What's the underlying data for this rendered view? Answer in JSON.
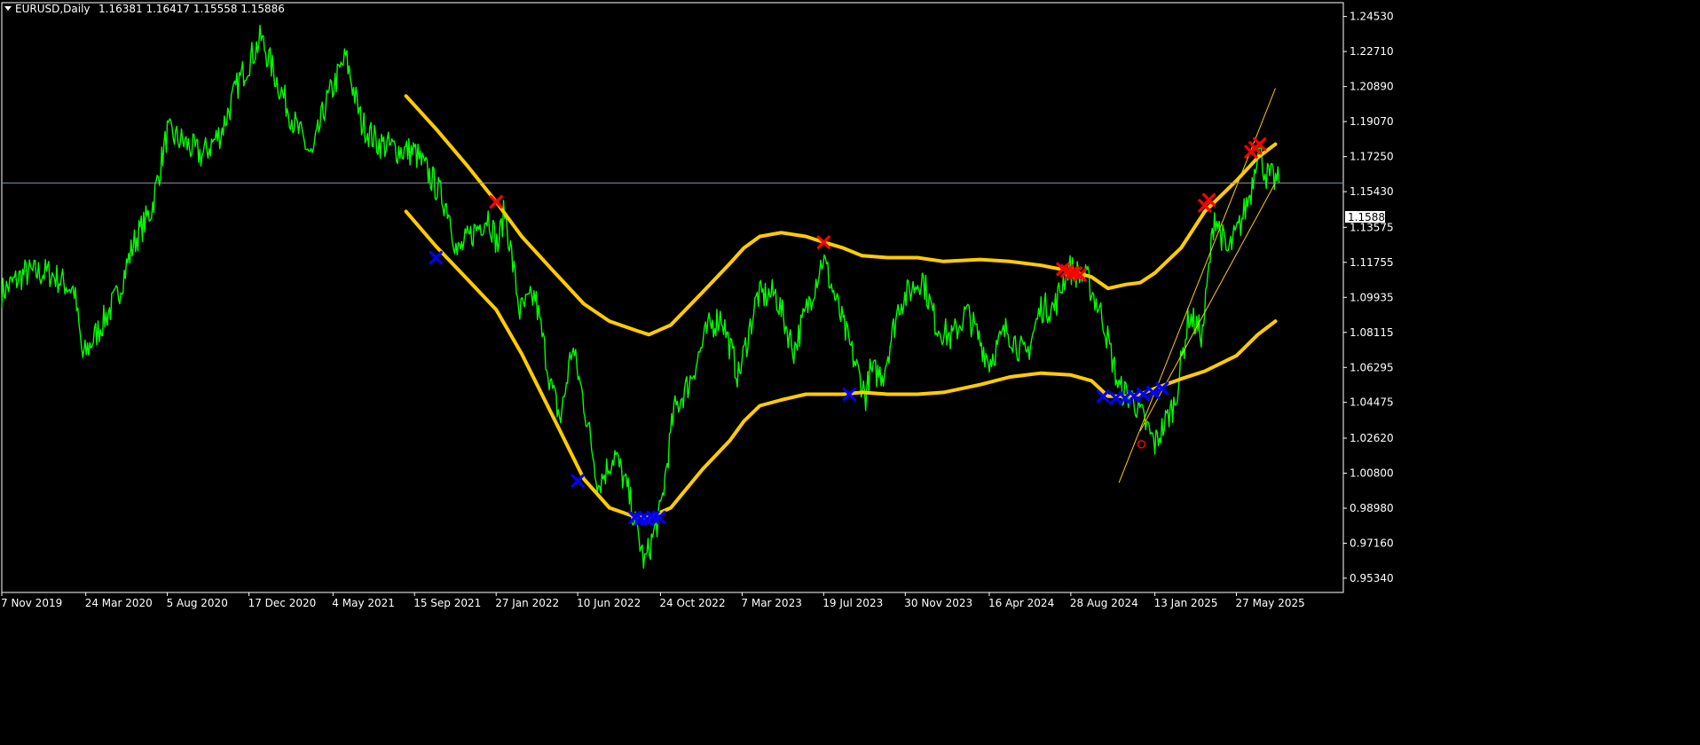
{
  "header": {
    "symbol_label": "EURUSD,Daily",
    "ohlc_text": "1.16381 1.16417 1.15558 1.15886"
  },
  "chart_data": {
    "type": "line",
    "title": "EURUSD,Daily",
    "ohlc": {
      "open": 1.16381,
      "high": 1.16417,
      "low": 1.15558,
      "close": 1.15886
    },
    "current_price_label": "1.15886",
    "current_price": 1.15886,
    "ylim": [
      0.946,
      1.2525
    ],
    "xlim": [
      "2019-11-07",
      "2025-09-30"
    ],
    "y_ticks": [
      "1.24530",
      "1.22710",
      "1.20890",
      "1.19070",
      "1.17250",
      "1.15430",
      "1.13575",
      "1.11755",
      "1.09935",
      "1.08115",
      "1.06295",
      "1.04475",
      "1.02620",
      "1.00800",
      "0.98980",
      "0.97160",
      "0.95340"
    ],
    "x_ticks": [
      "7 Nov 2019",
      "24 Mar 2020",
      "5 Aug 2020",
      "17 Dec 2020",
      "4 May 2021",
      "15 Sep 2021",
      "27 Jan 2022",
      "10 Jun 2022",
      "24 Oct 2022",
      "7 Mar 2023",
      "19 Jul 2023",
      "30 Nov 2023",
      "16 Apr 2024",
      "28 Aug 2024",
      "13 Jan 2025",
      "27 May 2025"
    ],
    "grid": false,
    "colors": {
      "background": "#000000",
      "price": "#00ff00",
      "band": "#ffcc00",
      "trendline": "#ffcc00",
      "sell_marker": "#ff0000",
      "buy_marker": "#0000ff",
      "hline": "#8899aa",
      "text": "#ffffff"
    },
    "series": [
      {
        "kind": "price",
        "x": [
          "2019-11-07",
          "2019-12-15",
          "2020-01-25",
          "2020-03-05",
          "2020-03-19",
          "2020-04-15",
          "2020-05-15",
          "2020-06-10",
          "2020-07-10",
          "2020-08-05",
          "2020-09-01",
          "2020-10-01",
          "2020-11-01",
          "2020-12-01",
          "2021-01-06",
          "2021-02-01",
          "2021-03-01",
          "2021-03-31",
          "2021-04-20",
          "2021-05-25",
          "2021-06-20",
          "2021-07-15",
          "2021-08-20",
          "2021-09-15",
          "2021-10-15",
          "2021-11-10",
          "2021-11-24",
          "2021-12-20",
          "2022-01-14",
          "2022-01-30",
          "2022-02-10",
          "2022-03-07",
          "2022-04-01",
          "2022-04-28",
          "2022-05-13",
          "2022-06-01",
          "2022-06-20",
          "2022-07-14",
          "2022-08-10",
          "2022-09-01",
          "2022-09-28",
          "2022-10-24",
          "2022-11-15",
          "2022-12-10",
          "2023-01-10",
          "2023-02-01",
          "2023-03-01",
          "2023-04-01",
          "2023-05-01",
          "2023-05-31",
          "2023-07-18",
          "2023-08-20",
          "2023-09-26",
          "2023-10-03",
          "2023-10-25",
          "2023-11-20",
          "2023-12-28",
          "2024-01-20",
          "2024-02-14",
          "2024-03-10",
          "2024-04-16",
          "2024-05-15",
          "2024-06-15",
          "2024-07-10",
          "2024-08-01",
          "2024-08-23",
          "2024-09-25",
          "2024-10-20",
          "2024-11-15",
          "2024-12-10",
          "2025-01-13",
          "2025-02-15",
          "2025-03-10",
          "2025-04-01",
          "2025-04-21",
          "2025-05-12",
          "2025-06-01",
          "2025-06-20",
          "2025-07-01",
          "2025-07-15",
          "2025-08-05"
        ],
        "values": [
          1.102,
          1.112,
          1.112,
          1.103,
          1.068,
          1.083,
          1.1,
          1.127,
          1.145,
          1.185,
          1.18,
          1.173,
          1.185,
          1.212,
          1.234,
          1.212,
          1.19,
          1.172,
          1.198,
          1.224,
          1.19,
          1.18,
          1.176,
          1.175,
          1.16,
          1.145,
          1.122,
          1.133,
          1.142,
          1.126,
          1.145,
          1.092,
          1.1,
          1.052,
          1.036,
          1.074,
          1.045,
          1.002,
          1.018,
          0.998,
          0.961,
          0.988,
          1.04,
          1.055,
          1.083,
          1.09,
          1.058,
          1.1,
          1.101,
          1.072,
          1.12,
          1.085,
          1.048,
          1.06,
          1.06,
          1.096,
          1.11,
          1.085,
          1.078,
          1.092,
          1.066,
          1.083,
          1.068,
          1.094,
          1.094,
          1.115,
          1.108,
          1.088,
          1.052,
          1.046,
          1.023,
          1.045,
          1.09,
          1.08,
          1.143,
          1.122,
          1.136,
          1.155,
          1.178,
          1.163,
          1.159
        ]
      },
      {
        "kind": "band-upper",
        "x": [
          "2021-09-01",
          "2021-10-20",
          "2021-12-10",
          "2022-01-27",
          "2022-03-10",
          "2022-05-01",
          "2022-06-20",
          "2022-08-01",
          "2022-09-15",
          "2022-10-05",
          "2022-11-10",
          "2023-01-01",
          "2023-02-15",
          "2023-03-10",
          "2023-04-05",
          "2023-05-10",
          "2023-06-20",
          "2023-07-19",
          "2023-08-20",
          "2023-09-20",
          "2023-11-01",
          "2023-12-20",
          "2024-02-01",
          "2024-04-01",
          "2024-05-20",
          "2024-07-10",
          "2024-08-28",
          "2024-10-01",
          "2024-10-28",
          "2024-11-25",
          "2024-12-20",
          "2025-01-13",
          "2025-02-25",
          "2025-04-05",
          "2025-05-27",
          "2025-07-01",
          "2025-07-30"
        ],
        "values": [
          1.204,
          1.187,
          1.168,
          1.149,
          1.131,
          1.113,
          1.096,
          1.087,
          1.082,
          1.08,
          1.085,
          1.102,
          1.117,
          1.125,
          1.131,
          1.133,
          1.131,
          1.128,
          1.125,
          1.121,
          1.12,
          1.12,
          1.118,
          1.119,
          1.118,
          1.116,
          1.113,
          1.11,
          1.104,
          1.106,
          1.107,
          1.112,
          1.125,
          1.144,
          1.16,
          1.172,
          1.179
        ]
      },
      {
        "kind": "band-lower",
        "x": [
          "2021-09-01",
          "2021-10-20",
          "2021-12-10",
          "2022-01-27",
          "2022-03-10",
          "2022-05-01",
          "2022-06-20",
          "2022-08-01",
          "2022-09-15",
          "2022-10-05",
          "2022-11-10",
          "2023-01-01",
          "2023-02-15",
          "2023-03-10",
          "2023-04-05",
          "2023-05-10",
          "2023-06-20",
          "2023-07-19",
          "2023-08-20",
          "2023-09-20",
          "2023-11-01",
          "2023-12-20",
          "2024-02-01",
          "2024-04-01",
          "2024-05-20",
          "2024-07-10",
          "2024-08-28",
          "2024-10-01",
          "2024-10-28",
          "2024-11-25",
          "2024-12-20",
          "2025-01-13",
          "2025-02-25",
          "2025-04-05",
          "2025-05-27",
          "2025-07-01",
          "2025-07-30"
        ],
        "values": [
          1.144,
          1.126,
          1.109,
          1.093,
          1.07,
          1.037,
          1.005,
          0.99,
          0.985,
          0.985,
          0.99,
          1.01,
          1.025,
          1.035,
          1.043,
          1.046,
          1.049,
          1.049,
          1.049,
          1.05,
          1.049,
          1.049,
          1.05,
          1.054,
          1.058,
          1.06,
          1.059,
          1.056,
          1.048,
          1.048,
          1.049,
          1.052,
          1.057,
          1.061,
          1.069,
          1.08,
          1.087
        ]
      },
      {
        "kind": "trendline",
        "x": [
          "2024-11-15",
          "2025-07-30"
        ],
        "values": [
          1.003,
          1.208
        ]
      },
      {
        "kind": "trendline",
        "x": [
          "2024-12-20",
          "2025-07-30"
        ],
        "values": [
          1.03,
          1.159
        ]
      }
    ],
    "markers": [
      {
        "kind": "sell",
        "x": "2022-01-27",
        "y": 1.149
      },
      {
        "kind": "sell",
        "x": "2023-07-19",
        "y": 1.128
      },
      {
        "kind": "sell",
        "x": "2024-08-15",
        "y": 1.114
      },
      {
        "kind": "sell",
        "x": "2024-08-22",
        "y": 1.113
      },
      {
        "kind": "sell",
        "x": "2024-08-29",
        "y": 1.112
      },
      {
        "kind": "sell",
        "x": "2024-09-05",
        "y": 1.112
      },
      {
        "kind": "sell",
        "x": "2024-09-12",
        "y": 1.111
      },
      {
        "kind": "sell",
        "x": "2025-04-05",
        "y": 1.147
      },
      {
        "kind": "sell",
        "x": "2025-04-12",
        "y": 1.15
      },
      {
        "kind": "sell",
        "x": "2025-06-20",
        "y": 1.175
      },
      {
        "kind": "sell",
        "x": "2025-06-27",
        "y": 1.177
      },
      {
        "kind": "sell",
        "x": "2025-07-04",
        "y": 1.179
      },
      {
        "kind": "buy",
        "x": "2021-10-20",
        "y": 1.12
      },
      {
        "kind": "buy",
        "x": "2022-06-10",
        "y": 1.004
      },
      {
        "kind": "buy",
        "x": "2022-09-12",
        "y": 0.985
      },
      {
        "kind": "buy",
        "x": "2022-09-22",
        "y": 0.984
      },
      {
        "kind": "buy",
        "x": "2022-10-02",
        "y": 0.984
      },
      {
        "kind": "buy",
        "x": "2022-10-12",
        "y": 0.985
      },
      {
        "kind": "buy",
        "x": "2022-10-22",
        "y": 0.985
      },
      {
        "kind": "buy",
        "x": "2023-08-30",
        "y": 1.049
      },
      {
        "kind": "buy",
        "x": "2024-10-20",
        "y": 1.048
      },
      {
        "kind": "buy",
        "x": "2024-11-10",
        "y": 1.047
      },
      {
        "kind": "buy",
        "x": "2024-11-25",
        "y": 1.047
      },
      {
        "kind": "buy",
        "x": "2024-12-10",
        "y": 1.048
      },
      {
        "kind": "buy",
        "x": "2024-12-25",
        "y": 1.049
      },
      {
        "kind": "buy",
        "x": "2025-01-10",
        "y": 1.05
      },
      {
        "kind": "buy",
        "x": "2025-01-25",
        "y": 1.052
      },
      {
        "kind": "ring",
        "x": "2024-12-22",
        "y": 1.023
      }
    ]
  }
}
